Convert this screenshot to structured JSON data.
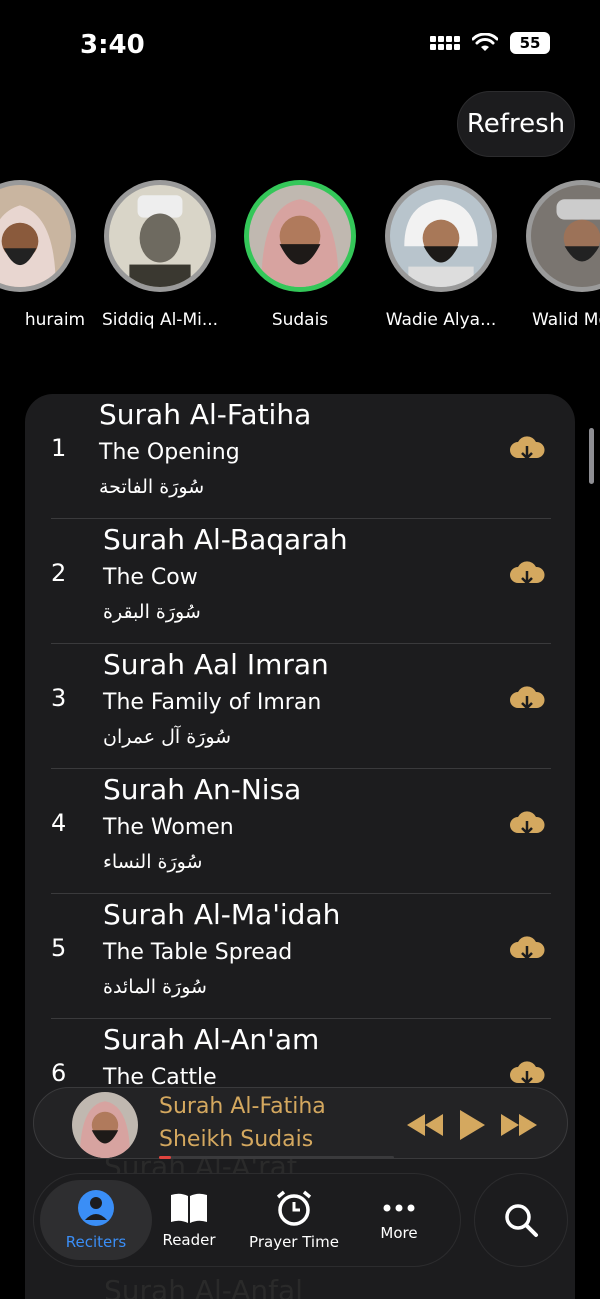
{
  "status_bar": {
    "time": "3:40",
    "battery": "55"
  },
  "header": {
    "refresh_label": "Refresh"
  },
  "reciters": [
    {
      "name": "huraim",
      "active": false
    },
    {
      "name": "Siddiq Al-Mi...",
      "active": false
    },
    {
      "name": "Sudais",
      "active": true
    },
    {
      "name": "Wadie Alya...",
      "active": false
    },
    {
      "name": "Walid Me",
      "active": false
    }
  ],
  "surahs": [
    {
      "number": "1",
      "title": "Surah Al-Fatiha",
      "english": "The Opening",
      "arabic": "سُورَة الفاتحة"
    },
    {
      "number": "2",
      "title": "Surah Al-Baqarah",
      "english": "The Cow",
      "arabic": "سُورَة البقرة"
    },
    {
      "number": "3",
      "title": "Surah Aal Imran",
      "english": "The Family of Imran",
      "arabic": "سُورَة آل عمران"
    },
    {
      "number": "4",
      "title": "Surah An-Nisa",
      "english": "The Women",
      "arabic": "سُورَة النساء"
    },
    {
      "number": "5",
      "title": "Surah Al-Ma'idah",
      "english": "The Table Spread",
      "arabic": "سُورَة المائدة"
    },
    {
      "number": "6",
      "title": "Surah Al-An'am",
      "english": "The Cattle",
      "arabic": ""
    }
  ],
  "ghost_rows": [
    "Surah Al-A'raf",
    "Surah Al-Anfal"
  ],
  "player": {
    "title": "Surah Al-Fatiha",
    "artist": "Sheikh Sudais",
    "progress": 0.05
  },
  "tabs": [
    {
      "label": "Reciters",
      "icon": "person-icon",
      "active": true
    },
    {
      "label": "Reader",
      "icon": "book-icon",
      "active": false
    },
    {
      "label": "Prayer Time",
      "icon": "alarm-clock-icon",
      "active": false
    },
    {
      "label": "More",
      "icon": "ellipsis-icon",
      "active": false
    }
  ],
  "colors": {
    "accent": "#d4a85f",
    "active_tab": "#3a8ef6",
    "active_ring": "#34c759",
    "panel": "#1c1c1e"
  }
}
